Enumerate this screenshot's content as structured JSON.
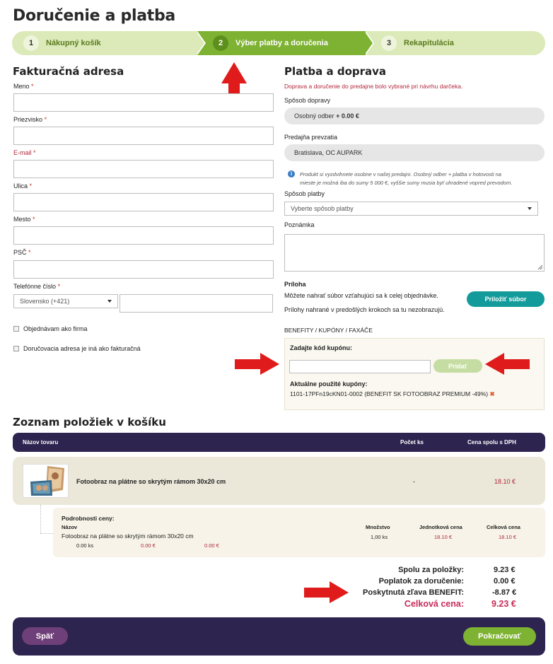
{
  "page_title": "Doručenie a platba",
  "steps": [
    {
      "num": "1",
      "label": "Nákupný košík"
    },
    {
      "num": "2",
      "label": "Výber platby a doručenia"
    },
    {
      "num": "3",
      "label": "Rekapitulácia"
    }
  ],
  "billing": {
    "title": "Fakturačná adresa",
    "fields": {
      "meno": "Meno",
      "priezvisko": "Priezvisko",
      "email": "E-mail",
      "ulica": "Ulica",
      "mesto": "Mesto",
      "psc": "PSČ",
      "telefon": "Telefónne číslo"
    },
    "required_mark": "*",
    "country_select": "Slovensko (+421)",
    "checkbox_company": "Objednávam ako firma",
    "checkbox_delivery": "Doručovacia adresa je iná ako fakturačná"
  },
  "payment": {
    "title": "Platba a doprava",
    "notice": "Doprava a doručenie do predajne bolo vybrané pri návrhu darčeka.",
    "shipping_label": "Spôsob dopravy",
    "shipping_value": "Osobný odber",
    "shipping_price": "+ 0.00 €",
    "store_label": "Predajňa prevzatia",
    "store_value": "Bratislava, OC AUPARK",
    "info_line1": "Produkt si vyzdvihnete osobne v našej predajni. Osobný odber + platba v hotovosti na",
    "info_line2": "mieste je možná iba do sumy 5 000 €, vyššie sumy musia byť uhradené vopred prevodom.",
    "method_label": "Spôsob platby",
    "method_placeholder": "Vyberte spôsob platby",
    "note_label": "Poznámka",
    "attach_label": "Príloha",
    "attach_text1": "Môžete nahrať súbor vzťahujúci sa k celej objednávke.",
    "attach_text2": "Prílohy nahrané v predošlých krokoch sa tu nezobrazujú.",
    "attach_button": "Priložiť súbor",
    "benefit_label": "BENEFITY / KUPÓNY / FAXÁČE",
    "coupon_label": "Zadajte kód kupónu:",
    "coupon_button": "Pridať",
    "applied_label": "Aktuálne použité kupóny:",
    "applied_value": "1101-17PFn19cKN01-0002 (BENEFIT SK FOTOOBRAZ PREMIUM -49%)"
  },
  "cart": {
    "title": "Zoznam položiek v košíku",
    "col_name": "Názov tovaru",
    "col_qty": "Počet ks",
    "col_price": "Cena spolu s DPH",
    "item_name": "Fotoobraz na plátne so skrytým rámom 30x20 cm",
    "item_qty": "-",
    "item_price": "18.10 €",
    "details_title": "Podrobnosti ceny:",
    "d_col_name": "Názov",
    "d_col_qty": "Množstvo",
    "d_col_unit": "Jednotková cena",
    "d_col_total": "Celková cena",
    "d_name": "Fotoobraz na plátne so skrytým rámom 30x20 cm",
    "d_qty": "1,00 ks",
    "d_unit": "18.10 €",
    "d_total": "18.10 €",
    "d_sub_qty": "0.00 ks",
    "d_sub_unit": "0.00 €",
    "d_sub_total": "0.00 €"
  },
  "summary": {
    "items_label": "Spolu za položky:",
    "items_value": "9.23 €",
    "delivery_label": "Poplatok za doručenie:",
    "delivery_value": "0.00 €",
    "discount_label": "Poskytnutá zľava BENEFIT:",
    "discount_value": "-8.87 €",
    "total_label": "Celková cena:",
    "total_value": "9.23 €"
  },
  "footer": {
    "back": "Späť",
    "next": "Pokračovať"
  },
  "colors": {
    "accent_green": "#7eb232",
    "dark_purple": "#2d2450",
    "price_red": "#b0263a",
    "teal": "#139b9b"
  }
}
